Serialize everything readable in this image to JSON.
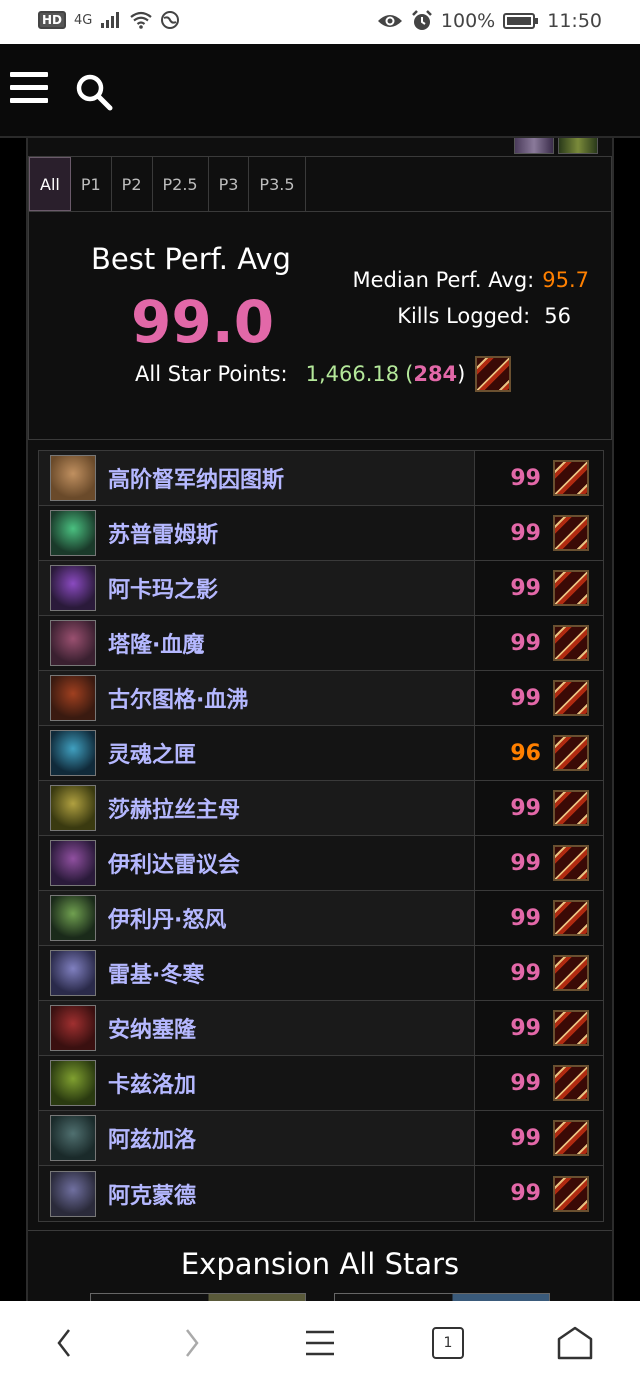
{
  "status_bar": {
    "left_badge": "HD",
    "network": "4G",
    "battery_percent": "100%",
    "time": "11:50"
  },
  "tabs": [
    {
      "label": "All",
      "active": true
    },
    {
      "label": "P1",
      "active": false
    },
    {
      "label": "P2",
      "active": false
    },
    {
      "label": "P2.5",
      "active": false
    },
    {
      "label": "P3",
      "active": false
    },
    {
      "label": "P3.5",
      "active": false
    }
  ],
  "summary": {
    "best_label": "Best Perf. Avg",
    "best_value": "99.0",
    "median_label": "Median Perf. Avg:",
    "median_value": "95.7",
    "kills_label": "Kills Logged:",
    "kills_value": "56",
    "all_star_label": "All Star Points:",
    "all_star_points": "1,466.18",
    "all_star_rank": "284"
  },
  "bosses": [
    {
      "name": "高阶督军纳因图斯",
      "score": "99",
      "color": "pink"
    },
    {
      "name": "苏普雷姆斯",
      "score": "99",
      "color": "pink"
    },
    {
      "name": "阿卡玛之影",
      "score": "99",
      "color": "pink"
    },
    {
      "name": "塔隆·血魔",
      "score": "99",
      "color": "pink"
    },
    {
      "name": "古尔图格·血沸",
      "score": "99",
      "color": "pink"
    },
    {
      "name": "灵魂之匣",
      "score": "96",
      "color": "orange"
    },
    {
      "name": "莎赫拉丝主母",
      "score": "99",
      "color": "pink"
    },
    {
      "name": "伊利达雷议会",
      "score": "99",
      "color": "pink"
    },
    {
      "name": "伊利丹·怒风",
      "score": "99",
      "color": "pink"
    },
    {
      "name": "雷基·冬寒",
      "score": "99",
      "color": "pink"
    },
    {
      "name": "安纳塞隆",
      "score": "99",
      "color": "pink"
    },
    {
      "name": "卡兹洛加",
      "score": "99",
      "color": "pink"
    },
    {
      "name": "阿兹加洛",
      "score": "99",
      "color": "pink"
    },
    {
      "name": "阿克蒙德",
      "score": "99",
      "color": "pink"
    }
  ],
  "expansion_title": "Expansion All Stars",
  "nav": {
    "tab_count": "1"
  },
  "colors": {
    "pink": "#e268a8",
    "orange": "#ff8000",
    "boss_name": "#b5b8ff"
  }
}
